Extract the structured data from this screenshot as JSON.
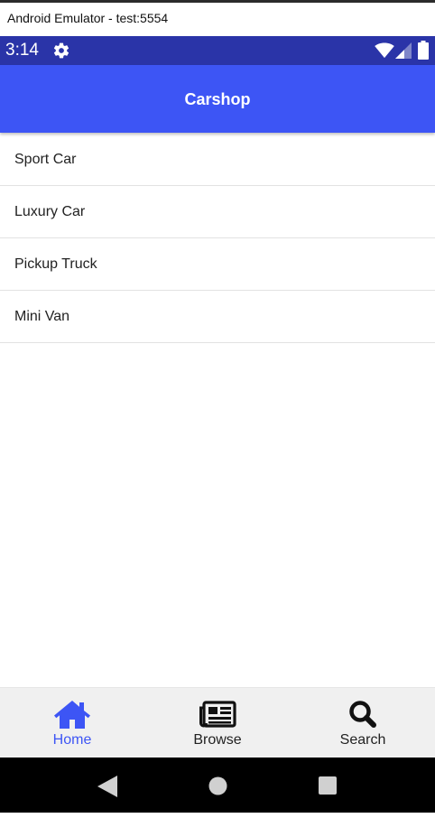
{
  "window": {
    "title": "Android Emulator - test:5554"
  },
  "status_bar": {
    "time": "3:14"
  },
  "app_bar": {
    "title": "Carshop"
  },
  "list": {
    "items": [
      {
        "label": "Sport Car"
      },
      {
        "label": "Luxury Car"
      },
      {
        "label": "Pickup Truck"
      },
      {
        "label": "Mini Van"
      }
    ]
  },
  "tabs": [
    {
      "label": "Home",
      "icon": "home-icon",
      "active": true
    },
    {
      "label": "Browse",
      "icon": "newspaper-icon",
      "active": false
    },
    {
      "label": "Search",
      "icon": "search-icon",
      "active": false
    }
  ],
  "colors": {
    "status_bar": "#2a34a8",
    "app_bar": "#3d55f5",
    "active_tab": "#3d55f5",
    "tab_bar": "#f0f0f0",
    "nav_bar": "#000000"
  }
}
